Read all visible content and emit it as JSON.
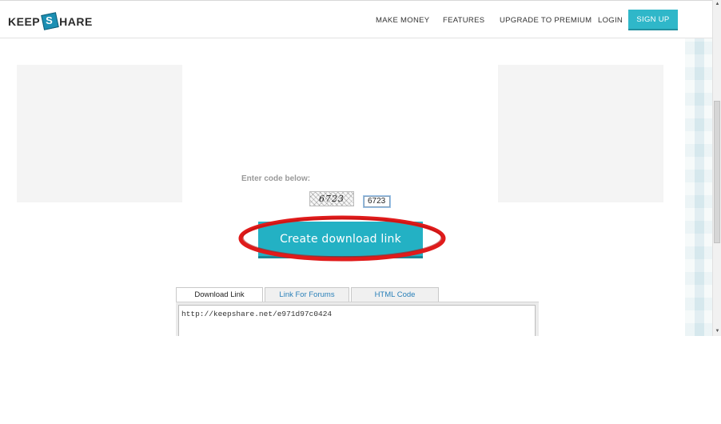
{
  "header": {
    "logo": {
      "left": "KEEP",
      "mark": "S",
      "right": "HARE"
    },
    "nav": [
      "MAKE MONEY",
      "FEATURES",
      "UPGRADE TO PREMIUM",
      "LOGIN"
    ],
    "signup_label": "SIGN UP"
  },
  "captcha": {
    "prompt": "Enter code below:",
    "image_text": "6723",
    "input_value": "6723"
  },
  "main": {
    "create_button_label": "Create download link"
  },
  "tabs": [
    {
      "label": "Download Link",
      "active": true
    },
    {
      "label": "Link For Forums",
      "active": false
    },
    {
      "label": "HTML Code",
      "active": false
    }
  ],
  "link_box": {
    "value": "http://keepshare.net/e971d97c0424"
  },
  "colors": {
    "accent": "#23b1c4",
    "signup": "#2fb7c9",
    "highlight_ellipse": "#e01b1b",
    "tab_link": "#2a80b9"
  },
  "icons": {
    "scroll_up": "scroll-up-arrow-icon",
    "scroll_down": "scroll-down-arrow-icon"
  }
}
